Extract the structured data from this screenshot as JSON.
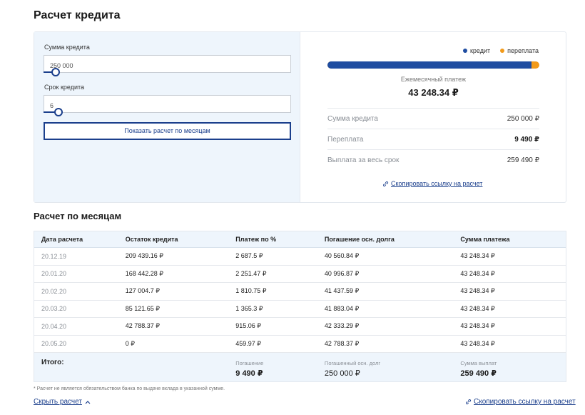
{
  "page_title": "Расчет кредита",
  "form": {
    "amount_label": "Сумма кредита",
    "amount_value": "250 000",
    "amount_slider_fraction": 0.05,
    "term_label": "Срок кредита",
    "term_value": "6",
    "term_slider_fraction": 0.06,
    "show_button": "Показать расчет по месяцам"
  },
  "summary": {
    "legend_credit": "кредит",
    "legend_overpay": "переплата",
    "credit_share_fraction": 0.9634,
    "colors": {
      "credit": "#1f4da1",
      "overpay": "#f29a1a",
      "accent": "#1b3f8c"
    },
    "monthly_label": "Ежемесячный платеж",
    "monthly_value": "43 248.34 ₽",
    "rows": [
      {
        "label": "Сумма кредита",
        "value": "250 000 ₽"
      },
      {
        "label": "Переплата",
        "value": "9 490 ₽"
      },
      {
        "label": "Выплата за весь срок",
        "value": "259 490 ₽"
      }
    ],
    "copy_link": "Скопировать ссылку на расчет"
  },
  "schedule": {
    "title": "Расчет по месяцам",
    "headers": [
      "Дата расчета",
      "Остаток кредита",
      "Платеж по %",
      "Погашение осн. долга",
      "Сумма платежа"
    ],
    "rows": [
      [
        "20.12.19",
        "209 439.16 ₽",
        "2 687.5 ₽",
        "40 560.84 ₽",
        "43 248.34 ₽"
      ],
      [
        "20.01.20",
        "168 442.28 ₽",
        "2 251.47 ₽",
        "40 996.87 ₽",
        "43 248.34 ₽"
      ],
      [
        "20.02.20",
        "127 004.7 ₽",
        "1 810.75 ₽",
        "41 437.59 ₽",
        "43 248.34 ₽"
      ],
      [
        "20.03.20",
        "85 121.65 ₽",
        "1 365.3 ₽",
        "41 883.04 ₽",
        "43 248.34 ₽"
      ],
      [
        "20.04.20",
        "42 788.37 ₽",
        "915.06 ₽",
        "42 333.29 ₽",
        "43 248.34 ₽"
      ],
      [
        "20.05.20",
        "0 ₽",
        "459.97 ₽",
        "42 788.37 ₽",
        "43 248.34 ₽"
      ]
    ],
    "total": {
      "label": "Итого:",
      "interest_label": "Погашение",
      "interest_value": "9 490 ₽",
      "principal_label": "Погашенный осн. долг",
      "principal_value": "250 000 ₽",
      "payments_label": "Сумма выплат",
      "payments_value": "259 490 ₽"
    }
  },
  "footer": {
    "disclaimer": "* Расчет не является обязательством банка по выдаче вклада в указанной сумме.",
    "hide_link": "Скрыть расчет",
    "copy_link": "Скопировать ссылку на расчет"
  }
}
